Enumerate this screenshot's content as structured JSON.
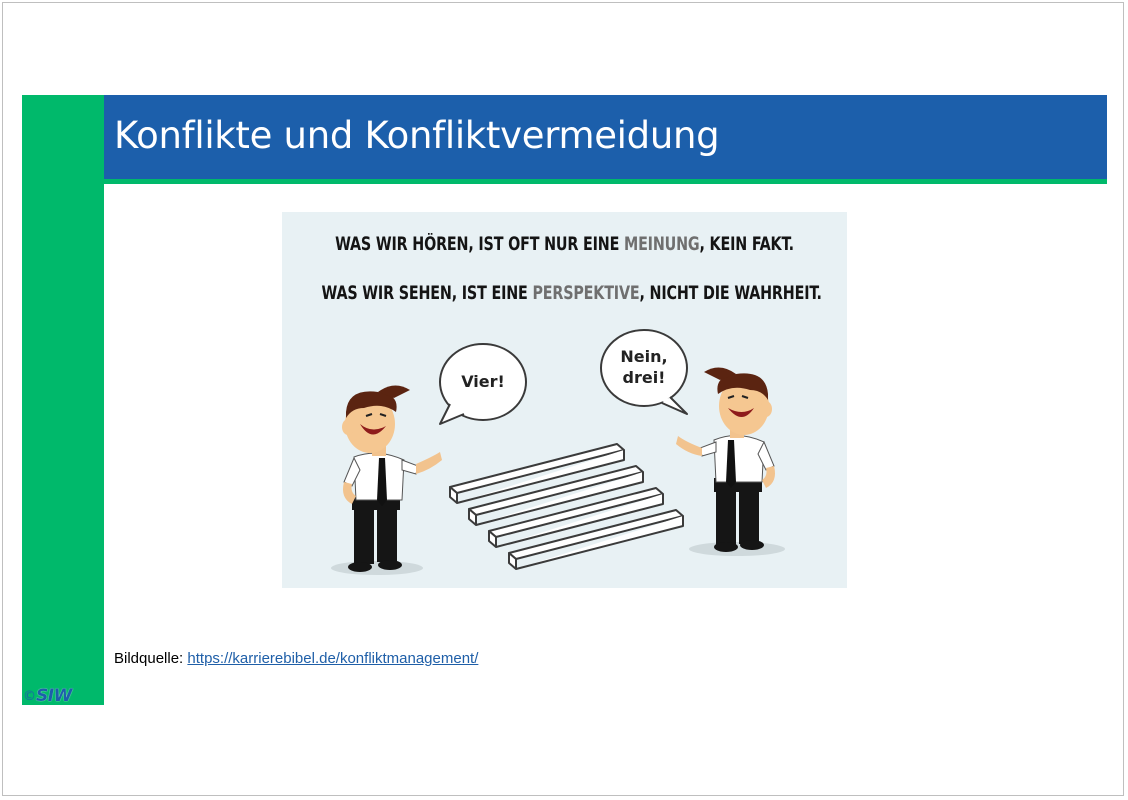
{
  "slide": {
    "title": "Konflikte und Konfliktvermeidung"
  },
  "illustration": {
    "line1_pre": "WAS WIR HÖREN, IST OFT NUR EINE ",
    "line1_highlight": "MEINUNG",
    "line1_post": ", KEIN FAKT.",
    "line2_pre": "WAS WIR SEHEN, IST EINE ",
    "line2_highlight": "PERSPEKTIVE",
    "line2_post": ", NICHT DIE WAHRHEIT.",
    "bubble_left": "Vier!",
    "bubble_right_line1": "Nein,",
    "bubble_right_line2": "drei!"
  },
  "source": {
    "label": "Bildquelle: ",
    "link_text": "https://karrierebibel.de/konfliktmanagement/"
  },
  "logo": {
    "copyright": "©",
    "text": "SIW"
  },
  "colors": {
    "brand_blue": "#1c5fab",
    "brand_green": "#00b96b",
    "illustration_bg": "#e8f1f4"
  }
}
